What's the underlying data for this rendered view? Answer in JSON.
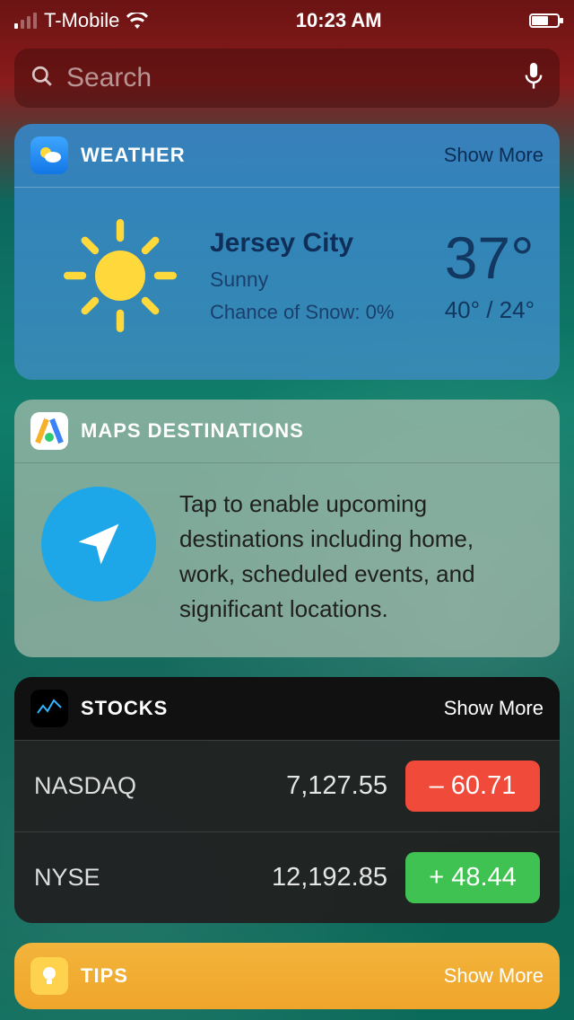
{
  "status": {
    "carrier": "T-Mobile",
    "time": "10:23 AM"
  },
  "search": {
    "placeholder": "Search"
  },
  "weather": {
    "title": "WEATHER",
    "show_more": "Show More",
    "location": "Jersey City",
    "condition": "Sunny",
    "precip_label": "Chance of Snow: 0%",
    "temp": "37°",
    "high_low": "40° / 24°"
  },
  "maps": {
    "title": "MAPS DESTINATIONS",
    "body": "Tap to enable upcoming destinations including home, work, scheduled events, and significant locations."
  },
  "stocks": {
    "title": "STOCKS",
    "show_more": "Show More",
    "rows": [
      {
        "symbol": "NASDAQ",
        "price": "7,127.55",
        "change": "– 60.71",
        "dir": "down"
      },
      {
        "symbol": "NYSE",
        "price": "12,192.85",
        "change": "+ 48.44",
        "dir": "up"
      }
    ]
  },
  "tips": {
    "title": "TIPS",
    "show_more": "Show More"
  }
}
